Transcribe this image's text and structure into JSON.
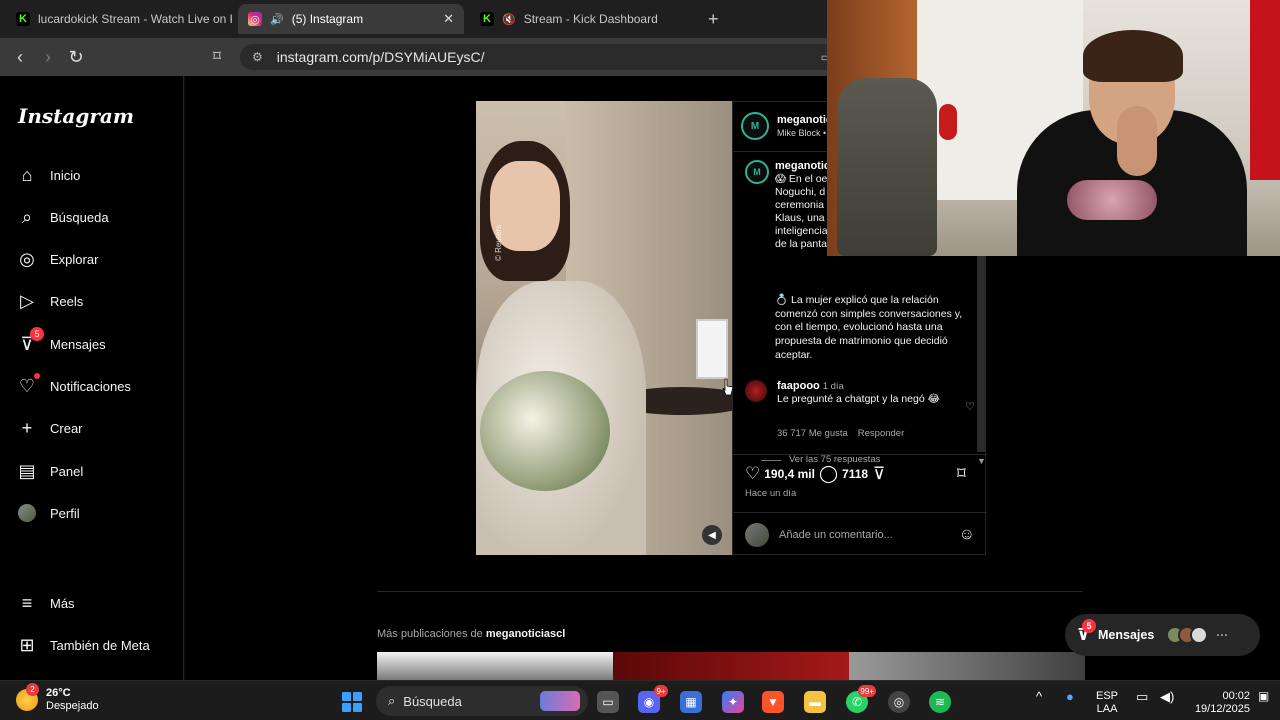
{
  "browser": {
    "tabs": [
      {
        "label": "lucardokick Stream - Watch Live on K",
        "icon": "kick-icon"
      },
      {
        "label": "(5) Instagram",
        "icon": "instagram-icon"
      },
      {
        "label": "Stream - Kick Dashboard",
        "icon": "kick-icon"
      }
    ],
    "url": "instagram.com/p/DSYMiAUEysC/"
  },
  "sidebar": {
    "logo": "Instagram",
    "items": [
      {
        "label": "Inicio",
        "icon": "home-icon"
      },
      {
        "label": "Búsqueda",
        "icon": "search-icon"
      },
      {
        "label": "Explorar",
        "icon": "compass-icon"
      },
      {
        "label": "Reels",
        "icon": "reels-icon"
      },
      {
        "label": "Mensajes",
        "icon": "messenger-icon",
        "badge": "5"
      },
      {
        "label": "Notificaciones",
        "icon": "heart-icon"
      },
      {
        "label": "Crear",
        "icon": "plus-icon"
      },
      {
        "label": "Panel",
        "icon": "chart-icon"
      },
      {
        "label": "Perfil",
        "icon": "avatar"
      }
    ],
    "more": "Más",
    "meta": "También de Meta"
  },
  "post": {
    "author": "meganotici",
    "audio": "Mike Block •",
    "avatar_text": "M",
    "media_credit": "© Reuters",
    "caption_author": "meganotici",
    "caption_lines": [
      "😱 En el oes",
      "Noguchi, d",
      "ceremonia s",
      "Klaus, una p",
      "inteligencia",
      "de la panta"
    ],
    "caption_more": "💍 La mujer explicó que la relación comenzó con simples conversaciones y, con el tiempo, evolucionó hasta una propuesta de matrimonio que decidió aceptar.",
    "comment": {
      "user": "faapooo",
      "time": "1 día",
      "text": "Le pregunté a chatgpt y la negó 😂",
      "likes": "36 717 Me gusta",
      "reply": "Responder",
      "view_replies": "Ver las 75 respuestas"
    },
    "likes": "190,4 mil",
    "comments_count": "7118",
    "posted": "Hace un día",
    "add_comment_placeholder": "Añade un comentario..."
  },
  "more_posts": {
    "prefix": "Más publicaciones de ",
    "account": "meganoticiascl"
  },
  "messages_float": {
    "label": "Mensajes",
    "badge": "5"
  },
  "taskbar": {
    "weather_temp": "26°C",
    "weather_desc": "Despejado",
    "weather_badge": "2",
    "search": "Búsqueda",
    "discord_badge": "9+",
    "whatsapp_badge": "99+",
    "lang1": "ESP",
    "lang2": "LAA",
    "time": "00:02",
    "date": "19/12/2025"
  }
}
